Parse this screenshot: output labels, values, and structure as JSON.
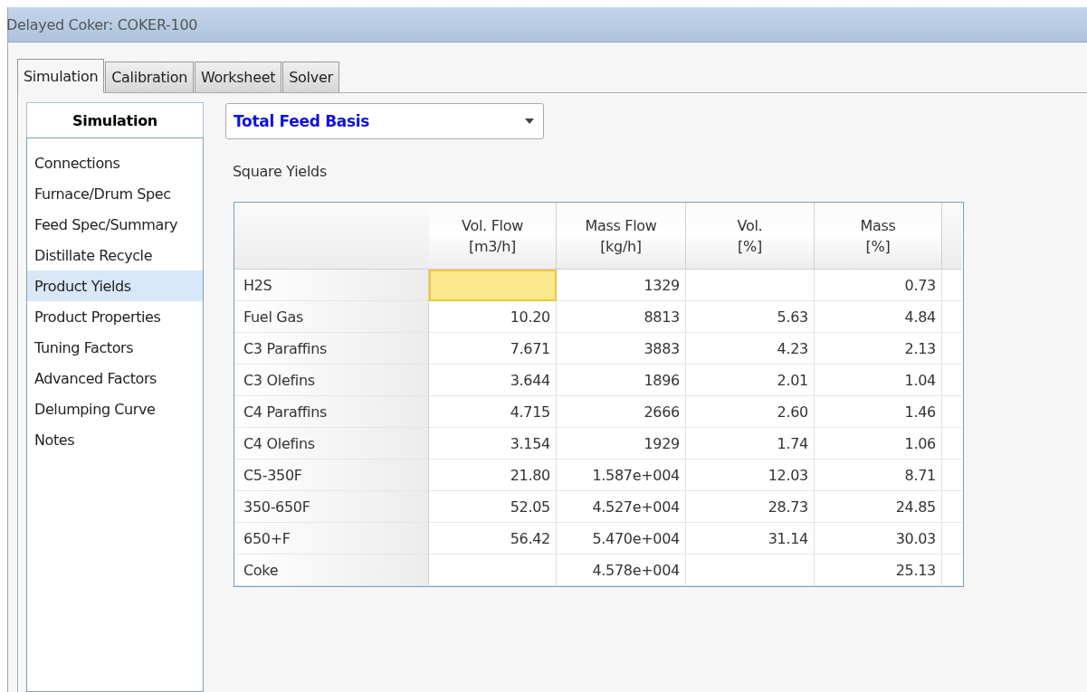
{
  "window": {
    "title": "Delayed Coker: COKER-100"
  },
  "tabs": [
    {
      "label": "Simulation",
      "selected": true
    },
    {
      "label": "Calibration",
      "selected": false
    },
    {
      "label": "Worksheet",
      "selected": false
    },
    {
      "label": "Solver",
      "selected": false
    }
  ],
  "sidebar": {
    "title": "Simulation",
    "items": [
      {
        "label": "Connections",
        "selected": false
      },
      {
        "label": "Furnace/Drum Spec",
        "selected": false
      },
      {
        "label": "Feed Spec/Summary",
        "selected": false
      },
      {
        "label": "Distillate Recycle",
        "selected": false
      },
      {
        "label": "Product Yields",
        "selected": true
      },
      {
        "label": "Product Properties",
        "selected": false
      },
      {
        "label": "Tuning Factors",
        "selected": false
      },
      {
        "label": "Advanced Factors",
        "selected": false
      },
      {
        "label": "Delumping Curve",
        "selected": false
      },
      {
        "label": "Notes",
        "selected": false
      }
    ]
  },
  "basis_dropdown": {
    "value": "Total Feed Basis"
  },
  "section_label": "Square Yields",
  "table": {
    "columns": [
      {
        "line1": "Vol. Flow",
        "line2": "[m3/h]"
      },
      {
        "line1": "Mass Flow",
        "line2": "[kg/h]"
      },
      {
        "line1": "Vol.",
        "line2": "[%]"
      },
      {
        "line1": "Mass",
        "line2": "[%]"
      }
    ],
    "rows": [
      {
        "label": "H2S",
        "cells": [
          {
            "selected": true
          },
          {
            "value": "1329",
            "selected": false
          },
          {
            "selected": false
          },
          {
            "value": "0.73",
            "selected": false
          }
        ]
      },
      {
        "label": "Fuel Gas",
        "cells": [
          {
            "value": "10.20",
            "selected": false
          },
          {
            "value": "8813",
            "selected": false
          },
          {
            "value": "5.63",
            "selected": false
          },
          {
            "value": "4.84",
            "selected": false
          }
        ]
      },
      {
        "label": "C3 Paraffins",
        "cells": [
          {
            "value": "7.671",
            "selected": false
          },
          {
            "value": "3883",
            "selected": false
          },
          {
            "value": "4.23",
            "selected": false
          },
          {
            "value": "2.13",
            "selected": false
          }
        ]
      },
      {
        "label": "C3 Olefins",
        "cells": [
          {
            "value": "3.644",
            "selected": false
          },
          {
            "value": "1896",
            "selected": false
          },
          {
            "value": "2.01",
            "selected": false
          },
          {
            "value": "1.04",
            "selected": false
          }
        ]
      },
      {
        "label": "C4 Paraffins",
        "cells": [
          {
            "value": "4.715",
            "selected": false
          },
          {
            "value": "2666",
            "selected": false
          },
          {
            "value": "2.60",
            "selected": false
          },
          {
            "value": "1.46",
            "selected": false
          }
        ]
      },
      {
        "label": "C4 Olefins",
        "cells": [
          {
            "value": "3.154",
            "selected": false
          },
          {
            "value": "1929",
            "selected": false
          },
          {
            "value": "1.74",
            "selected": false
          },
          {
            "value": "1.06",
            "selected": false
          }
        ]
      },
      {
        "label": "C5-350F",
        "cells": [
          {
            "value": "21.80",
            "selected": false
          },
          {
            "value": "1.587e+004",
            "selected": false
          },
          {
            "value": "12.03",
            "selected": false
          },
          {
            "value": "8.71",
            "selected": false
          }
        ]
      },
      {
        "label": "350-650F",
        "cells": [
          {
            "value": "52.05",
            "selected": false
          },
          {
            "value": "4.527e+004",
            "selected": false
          },
          {
            "value": "28.73",
            "selected": false
          },
          {
            "value": "24.85",
            "selected": false
          }
        ]
      },
      {
        "label": "650+F",
        "cells": [
          {
            "value": "56.42",
            "selected": false
          },
          {
            "value": "5.470e+004",
            "selected": false
          },
          {
            "value": "31.14",
            "selected": false
          },
          {
            "value": "30.03",
            "selected": false
          }
        ]
      },
      {
        "label": "Coke",
        "cells": [
          {
            "selected": false
          },
          {
            "value": "4.578e+004",
            "selected": false
          },
          {
            "selected": false
          },
          {
            "value": "25.13",
            "selected": false
          }
        ]
      }
    ]
  }
}
